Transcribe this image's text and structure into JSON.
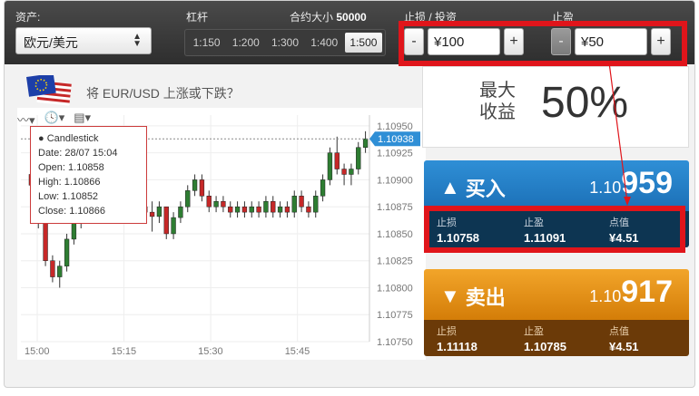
{
  "topbar": {
    "asset_label": "资产:",
    "asset_value": "欧元/美元",
    "leverage_label": "杠杆",
    "contract_label": "合约大小",
    "contract_value": "50000",
    "leverage_options": [
      "1:150",
      "1:200",
      "1:300",
      "1:400",
      "1:500"
    ],
    "leverage_selected": "1:500",
    "stoploss_label": "止损 / 投资",
    "stoploss_value": "¥100",
    "takeprofit_label": "止盈",
    "takeprofit_value": "¥50",
    "minus": "-",
    "plus": "+"
  },
  "question": "将 EUR/USD 上涨或下跌？",
  "tooltip": {
    "title": "● Candlestick",
    "date": "Date: 28/07 15:04",
    "open": "Open: 1.10858",
    "high": "High: 1.10866",
    "low": "Low: 1.10852",
    "close": "Close: 1.10866"
  },
  "payout": {
    "label_line1": "最大",
    "label_line2": "收益",
    "value": "50%"
  },
  "buy": {
    "label": "买入",
    "price_small": "1.10",
    "price_big": "959",
    "stoploss_label": "止损",
    "stoploss_value": "1.10758",
    "takeprofit_label": "止盈",
    "takeprofit_value": "1.11091",
    "points_label": "点值",
    "points_value": "¥4.51"
  },
  "sell": {
    "label": "卖出",
    "price_small": "1.10",
    "price_big": "917",
    "stoploss_label": "止损",
    "stoploss_value": "1.11118",
    "takeprofit_label": "止盈",
    "takeprofit_value": "1.10785",
    "points_label": "点值",
    "points_value": "¥4.51"
  },
  "colors": {
    "up": "#2e7d32",
    "down": "#c62828",
    "buy": "#1b6fb6",
    "sell": "#d47d08",
    "highlight": "#e0151b"
  },
  "chart_data": {
    "type": "candlestick",
    "x_ticks": [
      "15:00",
      "15:15",
      "15:30",
      "15:45"
    ],
    "y_ticks": [
      "1.10950",
      "1.10925",
      "1.10900",
      "1.10875",
      "1.10850",
      "1.10825",
      "1.10800",
      "1.10775",
      "1.10750"
    ],
    "ylim": [
      1.1075,
      1.1096
    ],
    "current_price": "1.10938",
    "candles": [
      [
        1.10905,
        1.10895,
        1.1091,
        1.1089
      ],
      [
        1.1089,
        1.1086,
        1.10895,
        1.10855
      ],
      [
        1.1086,
        1.10825,
        1.10865,
        1.1082
      ],
      [
        1.10825,
        1.1081,
        1.1083,
        1.10805
      ],
      [
        1.1081,
        1.1082,
        1.10825,
        1.108
      ],
      [
        1.1082,
        1.10845,
        1.1085,
        1.10815
      ],
      [
        1.10845,
        1.1086,
        1.10865,
        1.1084
      ],
      [
        1.1086,
        1.1088,
        1.10885,
        1.10855
      ],
      [
        1.1088,
        1.10865,
        1.10885,
        1.1086
      ],
      [
        1.10865,
        1.10875,
        1.1088,
        1.1086
      ],
      [
        1.10875,
        1.10865,
        1.1088,
        1.1086
      ],
      [
        1.10865,
        1.10875,
        1.1088,
        1.1086
      ],
      [
        1.10875,
        1.1087,
        1.1088,
        1.10865
      ],
      [
        1.1087,
        1.10875,
        1.1088,
        1.10865
      ],
      [
        1.10875,
        1.10885,
        1.1089,
        1.1087
      ],
      [
        1.10885,
        1.10875,
        1.1089,
        1.1087
      ],
      [
        1.10875,
        1.1087,
        1.1088,
        1.1086
      ],
      [
        1.1087,
        1.10866,
        1.1088,
        1.10852
      ],
      [
        1.10866,
        1.10875,
        1.1088,
        1.1086
      ],
      [
        1.10875,
        1.1085,
        1.10875,
        1.10845
      ],
      [
        1.1085,
        1.10865,
        1.1087,
        1.10845
      ],
      [
        1.10865,
        1.10875,
        1.1088,
        1.1086
      ],
      [
        1.10875,
        1.1089,
        1.10895,
        1.1087
      ],
      [
        1.1089,
        1.109,
        1.10905,
        1.10885
      ],
      [
        1.109,
        1.10885,
        1.10905,
        1.1088
      ],
      [
        1.10885,
        1.10875,
        1.1089,
        1.1087
      ],
      [
        1.10875,
        1.1088,
        1.10885,
        1.1087
      ],
      [
        1.1088,
        1.10875,
        1.10885,
        1.1087
      ],
      [
        1.10875,
        1.1087,
        1.1088,
        1.10865
      ],
      [
        1.1087,
        1.10875,
        1.1088,
        1.10865
      ],
      [
        1.10875,
        1.1087,
        1.1088,
        1.10865
      ],
      [
        1.1087,
        1.10875,
        1.1088,
        1.10865
      ],
      [
        1.10875,
        1.1087,
        1.1088,
        1.10865
      ],
      [
        1.1087,
        1.1088,
        1.10885,
        1.10865
      ],
      [
        1.1088,
        1.1087,
        1.10885,
        1.10865
      ],
      [
        1.1087,
        1.10875,
        1.1088,
        1.10865
      ],
      [
        1.10875,
        1.1087,
        1.1088,
        1.10865
      ],
      [
        1.1087,
        1.10885,
        1.1089,
        1.10865
      ],
      [
        1.10885,
        1.10875,
        1.1089,
        1.1087
      ],
      [
        1.10875,
        1.1087,
        1.1088,
        1.10865
      ],
      [
        1.1087,
        1.10885,
        1.1089,
        1.10865
      ],
      [
        1.10885,
        1.109,
        1.10905,
        1.1088
      ],
      [
        1.109,
        1.10925,
        1.1093,
        1.10895
      ],
      [
        1.10925,
        1.1091,
        1.1094,
        1.10905
      ],
      [
        1.1091,
        1.10905,
        1.10915,
        1.10895
      ],
      [
        1.10905,
        1.1091,
        1.10915,
        1.10895
      ],
      [
        1.1091,
        1.1093,
        1.10935,
        1.10905
      ],
      [
        1.1093,
        1.10938,
        1.10945,
        1.10925
      ]
    ]
  }
}
